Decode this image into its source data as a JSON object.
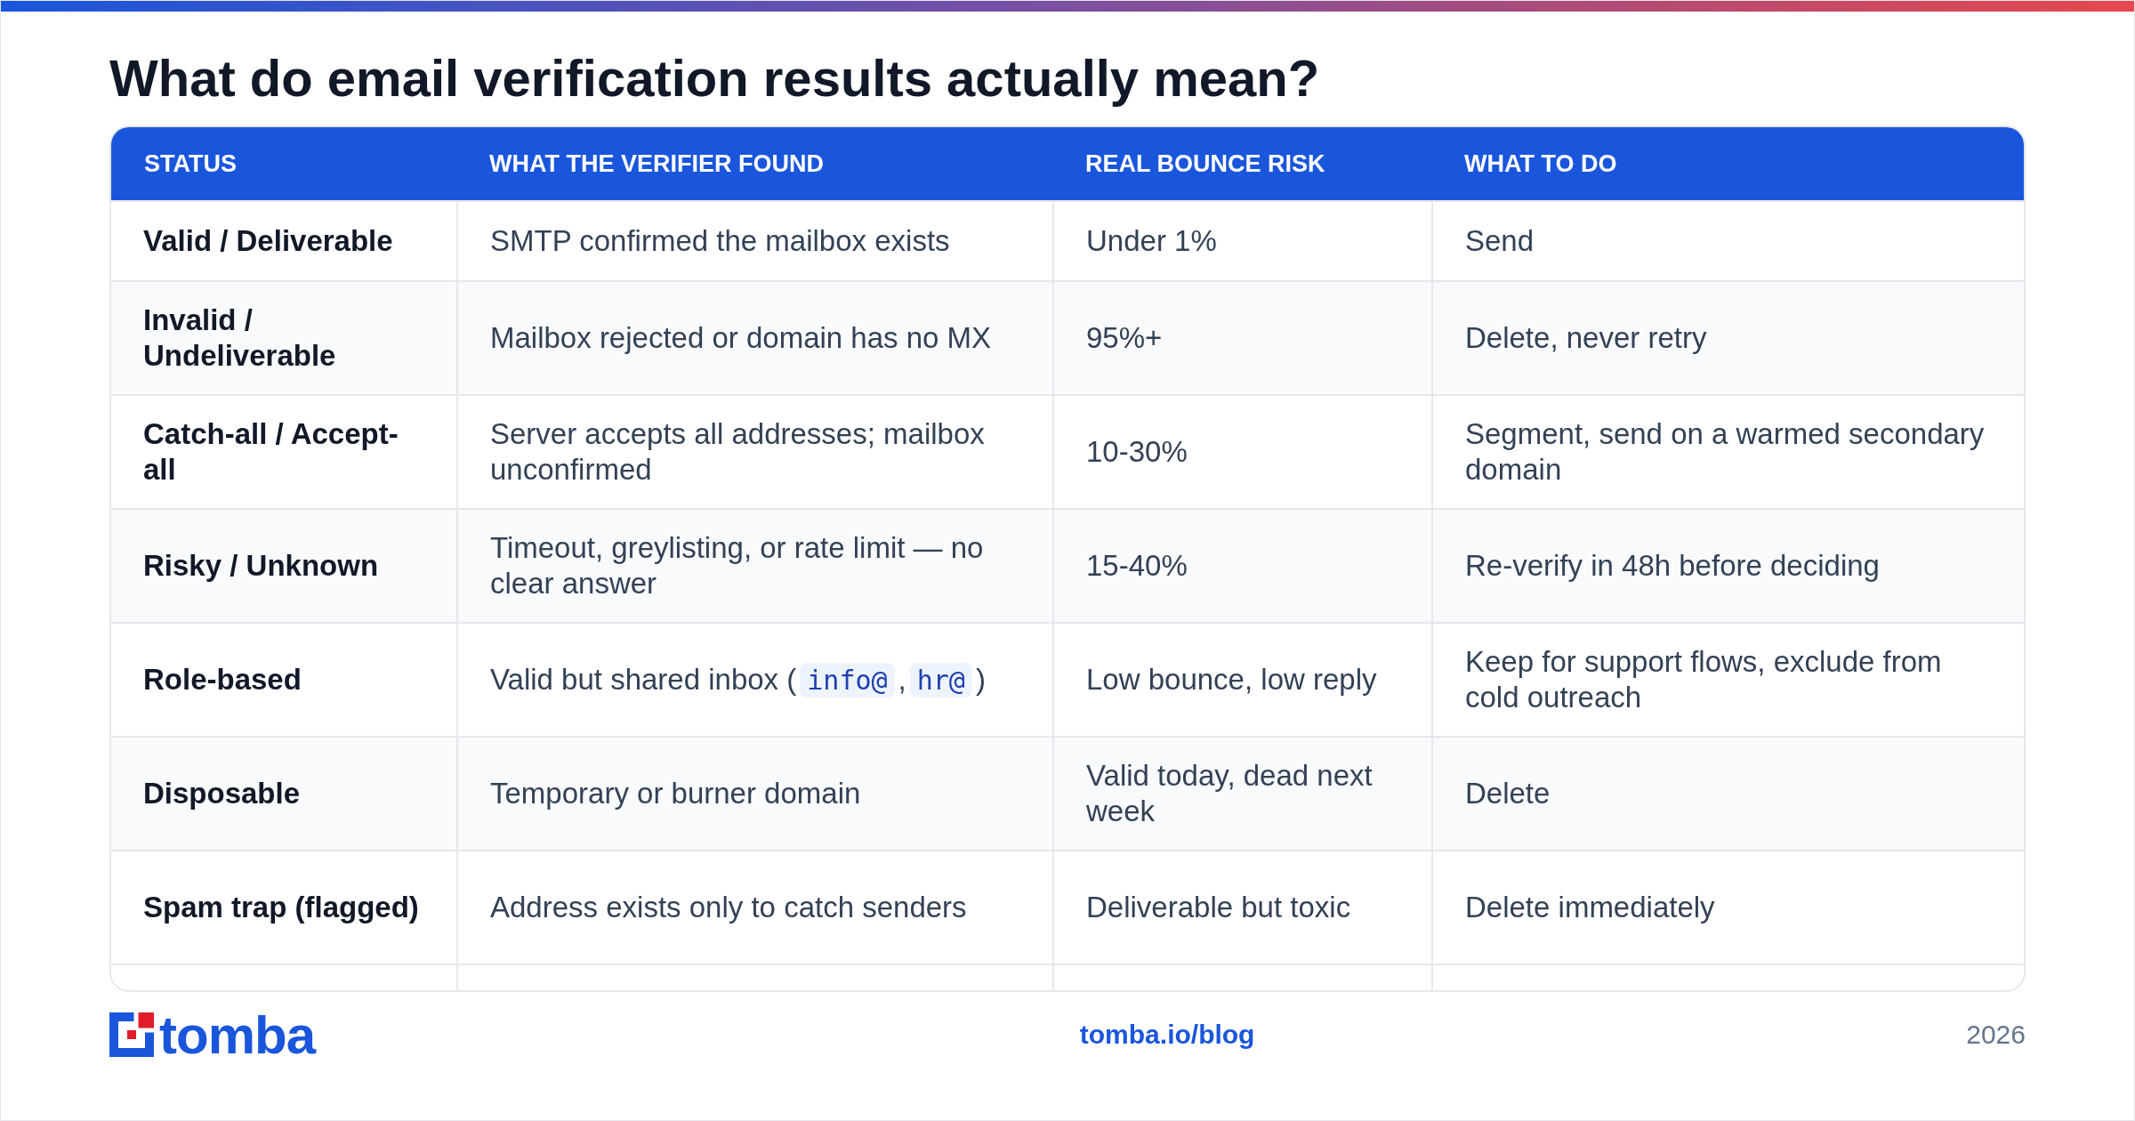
{
  "title": "What do email verification results actually mean?",
  "table": {
    "columns": [
      "STATUS",
      "WHAT THE VERIFIER FOUND",
      "REAL BOUNCE RISK",
      "WHAT TO DO"
    ],
    "rows": [
      {
        "status": "Valid / Deliverable",
        "found": [
          {
            "kind": "text",
            "text": "SMTP confirmed the mailbox exists"
          }
        ],
        "risk": "Under 1%",
        "action": "Send"
      },
      {
        "status": "Invalid / Undeliverable",
        "found": [
          {
            "kind": "text",
            "text": "Mailbox rejected or domain has no MX"
          }
        ],
        "risk": "95%+",
        "action": "Delete, never retry"
      },
      {
        "status": "Catch-all / Accept-all",
        "found": [
          {
            "kind": "text",
            "text": "Server accepts all addresses; mailbox unconfirmed"
          }
        ],
        "risk": "10-30%",
        "action": "Segment, send on a warmed secondary domain"
      },
      {
        "status": "Risky / Unknown",
        "found": [
          {
            "kind": "text",
            "text": "Timeout, greylisting, or rate limit — no clear answer"
          }
        ],
        "risk": "15-40%",
        "action": "Re-verify in 48h before deciding"
      },
      {
        "status": "Role-based",
        "found": [
          {
            "kind": "text",
            "text": "Valid but shared inbox ("
          },
          {
            "kind": "code",
            "text": "info@"
          },
          {
            "kind": "text",
            "text": ","
          },
          {
            "kind": "code",
            "text": "hr@"
          },
          {
            "kind": "text",
            "text": ")"
          }
        ],
        "risk": "Low bounce, low reply",
        "action": "Keep for support flows, exclude from cold outreach"
      },
      {
        "status": "Disposable",
        "found": [
          {
            "kind": "text",
            "text": "Temporary or burner domain"
          }
        ],
        "risk": "Valid today, dead next week",
        "action": "Delete"
      },
      {
        "status": "Spam trap (flagged)",
        "found": [
          {
            "kind": "text",
            "text": "Address exists only to catch senders"
          }
        ],
        "risk": "Deliverable but toxic",
        "action": "Delete immediately"
      }
    ]
  },
  "footer": {
    "logo_text": "tomba",
    "link": "tomba.io/blog",
    "year": "2026"
  }
}
